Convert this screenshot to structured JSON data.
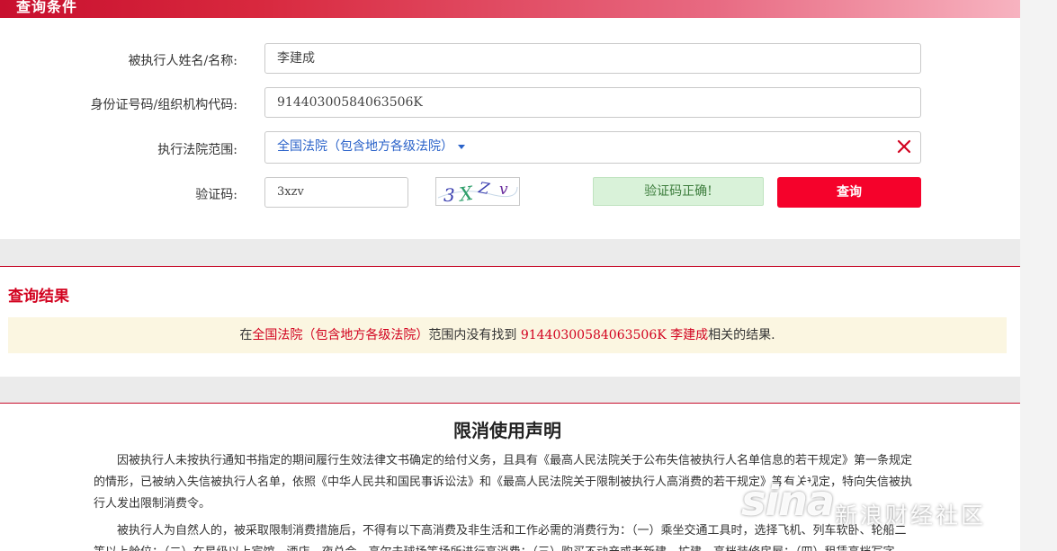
{
  "search_panel": {
    "title": "查询条件",
    "name_label": "被执行人姓名/名称:",
    "name_value": "李建成",
    "id_label": "身份证号码/组织机构代码:",
    "id_value": "91440300584063506K",
    "court_label": "执行法院范围:",
    "court_value": "全国法院（包含地方各级法院）",
    "captcha_label": "验证码:",
    "captcha_value": "3xzv",
    "captcha_image_text": "3XZv",
    "captcha_status": "验证码正确!",
    "query_button": "查询"
  },
  "results": {
    "title": "查询结果",
    "prefix": "在",
    "court": "全国法院（包含地方各级法院）",
    "middle": "范围内没有找到",
    "id": "91440300584063506K",
    "name": "李建成",
    "suffix": "相关的结果."
  },
  "declaration": {
    "title": "限消使用声明",
    "paragraph_1": "因被执行人未按执行通知书指定的期间履行生效法律文书确定的给付义务，且具有《最高人民法院关于公布失信被执行人名单信息的若干规定》第一条规定的情形，已被纳入失信被执行人名单，依照《中华人民共和国民事诉讼法》和《最高人民法院关于限制被执行人高消费的若干规定》等有关规定，特向失信被执行人发出限制消费令。",
    "paragraph_2": "被执行人为自然人的，被采取限制消费措施后，不得有以下高消费及非生活和工作必需的消费行为：（一）乘坐交通工具时，选择飞机、列车软卧、轮船二等以上舱位；（二）在星级以上宾馆、酒店、夜总会、高尔夫球场等场所进行高消费；（三）购买不动产或者新建、扩建、高档装修房屋；（四）租赁高档写字"
  },
  "watermark": {
    "logo": "sina",
    "text": "新浪财经社区"
  },
  "colors": {
    "brand_red": "#c8102e",
    "button_red": "#f5022b",
    "link_blue": "#2a62c9",
    "success_bg": "#d9f2d9",
    "result_bg": "#fbf6e1"
  },
  "icons": {
    "court_dropdown": "caret-down-icon",
    "court_clear": "close-icon"
  }
}
